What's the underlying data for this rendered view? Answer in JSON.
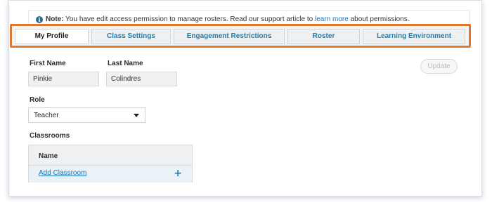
{
  "note": {
    "label": "Note:",
    "text_before": "You have edit access permission to manage rosters. Read our support article to",
    "link": "learn more",
    "text_after": "about permissions."
  },
  "tabs": [
    {
      "label": "My Profile",
      "active": true
    },
    {
      "label": "Class Settings",
      "active": false
    },
    {
      "label": "Engagement Restrictions",
      "active": false
    },
    {
      "label": "Roster",
      "active": false
    },
    {
      "label": "Learning Environment",
      "active": false
    }
  ],
  "profile": {
    "first_name_label": "First Name",
    "first_name_value": "Pinkie",
    "last_name_label": "Last Name",
    "last_name_value": "Colindres",
    "role_label": "Role",
    "role_value": "Teacher",
    "update_label": "Update",
    "update_enabled": false
  },
  "classrooms": {
    "label": "Classrooms",
    "column_header": "Name",
    "add_link": "Add Classroom",
    "add_icon": "+"
  },
  "colors": {
    "highlight_border": "#df7a32",
    "link": "#1a73b5",
    "tab_text": "#1a7fb2"
  }
}
